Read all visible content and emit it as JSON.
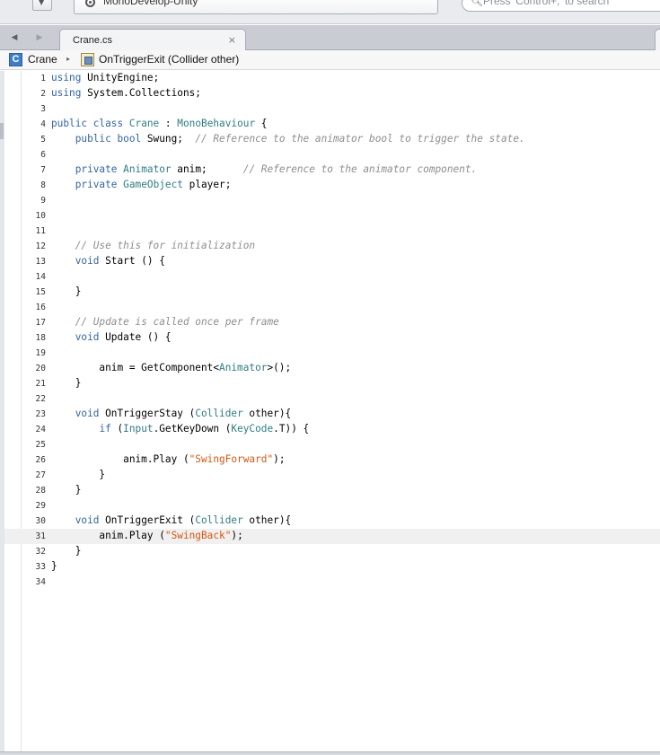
{
  "toolbar": {
    "status_text": "MonoDevelop-Unity",
    "search_placeholder": "Press 'Control+,' to search"
  },
  "tabs": [
    {
      "label": "Crane.cs",
      "close": "×"
    }
  ],
  "breadcrumb": {
    "class_icon_letter": "C",
    "class_name": "Crane",
    "separator": "▸",
    "method_signature": "OnTriggerExit (Collider other)"
  },
  "editor": {
    "file": "Crane.cs",
    "current_line": 31,
    "lines": [
      {
        "n": 1,
        "tokens": [
          [
            "kw",
            "using"
          ],
          [
            "",
            ""
          ],
          [
            "",
            " UnityEngine;"
          ]
        ]
      },
      {
        "n": 2,
        "tokens": [
          [
            "kw",
            "using"
          ],
          [
            "",
            " System.Collections;"
          ]
        ]
      },
      {
        "n": 3,
        "tokens": []
      },
      {
        "n": 4,
        "tokens": [
          [
            "kw",
            "public class"
          ],
          [
            "",
            " "
          ],
          [
            "ty",
            "Crane"
          ],
          [
            "",
            " : "
          ],
          [
            "ty",
            "MonoBehaviour"
          ],
          [
            "",
            " {"
          ]
        ]
      },
      {
        "n": 5,
        "tokens": [
          [
            "",
            "    "
          ],
          [
            "kw",
            "public bool"
          ],
          [
            "",
            " Swung;  "
          ],
          [
            "cm",
            "// Reference to the animator bool to trigger the state."
          ]
        ]
      },
      {
        "n": 6,
        "tokens": []
      },
      {
        "n": 7,
        "tokens": [
          [
            "",
            "    "
          ],
          [
            "kw",
            "private"
          ],
          [
            "",
            " "
          ],
          [
            "ty",
            "Animator"
          ],
          [
            "",
            " anim;      "
          ],
          [
            "cm",
            "// Reference to the animator component."
          ]
        ]
      },
      {
        "n": 8,
        "tokens": [
          [
            "",
            "    "
          ],
          [
            "kw",
            "private"
          ],
          [
            "",
            " "
          ],
          [
            "ty",
            "GameObject"
          ],
          [
            "",
            " player;"
          ]
        ]
      },
      {
        "n": 9,
        "tokens": []
      },
      {
        "n": 10,
        "tokens": []
      },
      {
        "n": 11,
        "tokens": []
      },
      {
        "n": 12,
        "tokens": [
          [
            "",
            "    "
          ],
          [
            "cm",
            "// Use this for initialization"
          ]
        ]
      },
      {
        "n": 13,
        "tokens": [
          [
            "",
            "    "
          ],
          [
            "kw",
            "void"
          ],
          [
            "",
            " Start () {"
          ]
        ]
      },
      {
        "n": 14,
        "tokens": []
      },
      {
        "n": 15,
        "tokens": [
          [
            "",
            "    }"
          ]
        ]
      },
      {
        "n": 16,
        "tokens": []
      },
      {
        "n": 17,
        "tokens": [
          [
            "",
            "    "
          ],
          [
            "cm",
            "// Update is called once per frame"
          ]
        ]
      },
      {
        "n": 18,
        "tokens": [
          [
            "",
            "    "
          ],
          [
            "kw",
            "void"
          ],
          [
            "",
            " Update () {"
          ]
        ]
      },
      {
        "n": 19,
        "tokens": []
      },
      {
        "n": 20,
        "tokens": [
          [
            "",
            "        anim = GetComponent<"
          ],
          [
            "ty",
            "Animator"
          ],
          [
            "",
            ">();"
          ]
        ]
      },
      {
        "n": 21,
        "tokens": [
          [
            "",
            "    }"
          ]
        ]
      },
      {
        "n": 22,
        "tokens": []
      },
      {
        "n": 23,
        "tokens": [
          [
            "",
            "    "
          ],
          [
            "kw",
            "void"
          ],
          [
            "",
            " OnTriggerStay ("
          ],
          [
            "ty",
            "Collider"
          ],
          [
            "",
            " other){"
          ]
        ]
      },
      {
        "n": 24,
        "tokens": [
          [
            "",
            "        "
          ],
          [
            "kw",
            "if"
          ],
          [
            "",
            " ("
          ],
          [
            "ty",
            "Input"
          ],
          [
            "",
            ".GetKeyDown ("
          ],
          [
            "ty",
            "KeyCode"
          ],
          [
            "",
            ".T)) {"
          ]
        ]
      },
      {
        "n": 25,
        "tokens": []
      },
      {
        "n": 26,
        "tokens": [
          [
            "",
            "            anim.Play ("
          ],
          [
            "st",
            "\"SwingForward\""
          ],
          [
            "",
            ");"
          ]
        ]
      },
      {
        "n": 27,
        "tokens": [
          [
            "",
            "        }"
          ]
        ]
      },
      {
        "n": 28,
        "tokens": [
          [
            "",
            "    }"
          ]
        ]
      },
      {
        "n": 29,
        "tokens": []
      },
      {
        "n": 30,
        "tokens": [
          [
            "",
            "    "
          ],
          [
            "kw",
            "void"
          ],
          [
            "",
            " OnTriggerExit ("
          ],
          [
            "ty",
            "Collider"
          ],
          [
            "",
            " other){"
          ]
        ]
      },
      {
        "n": 31,
        "tokens": [
          [
            "",
            "        anim.Play ("
          ],
          [
            "st",
            "\"SwingBack\""
          ],
          [
            "",
            ");"
          ]
        ]
      },
      {
        "n": 32,
        "tokens": [
          [
            "",
            "    }"
          ]
        ]
      },
      {
        "n": 33,
        "tokens": [
          [
            "",
            "}"
          ]
        ]
      },
      {
        "n": 34,
        "tokens": []
      }
    ]
  }
}
